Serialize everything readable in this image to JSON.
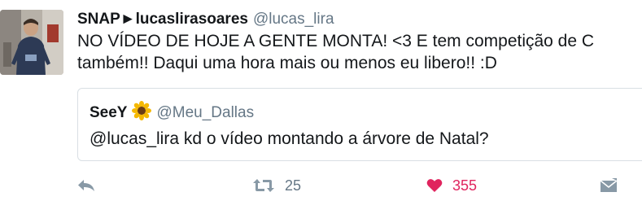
{
  "tweet": {
    "display_name": "SNAP►lucaslirasoares",
    "handle": "@lucas_lira",
    "text_line1": "NO VÍDEO DE HOJE A GENTE MONTA! <3 E tem competição de C",
    "text_line2": "também!! Daqui uma hora mais ou menos eu libero!! :D"
  },
  "quote": {
    "display_name": "SeeY",
    "emoji_icon": "sunflower-icon",
    "handle": "@Meu_Dallas",
    "text": "@lucas_lira kd o vídeo montando a árvore de Natal?"
  },
  "actions": {
    "reply_icon": "reply-icon",
    "retweet_icon": "retweet-icon",
    "retweet_count": "25",
    "like_icon": "heart-icon",
    "like_count": "355",
    "dm_icon": "envelope-icon"
  },
  "colors": {
    "handle_gray": "#657786",
    "icon_gray": "#8899a6",
    "like_red": "#e0245e",
    "border": "#d9dfe4"
  }
}
